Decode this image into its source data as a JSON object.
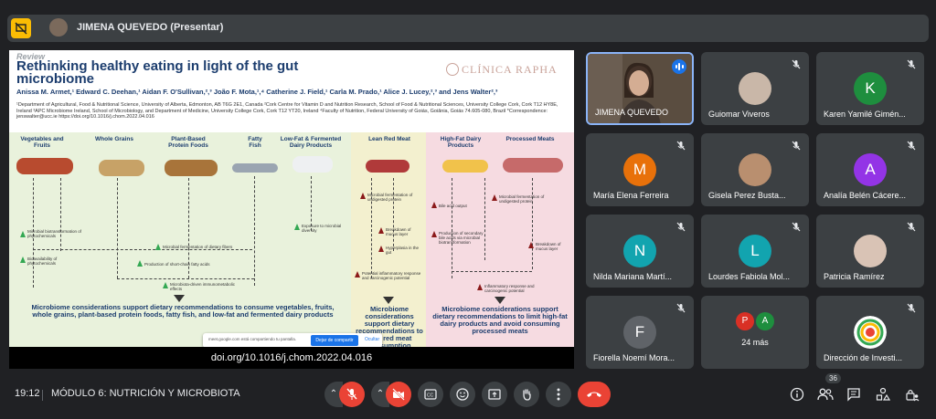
{
  "presenter": {
    "label": "JIMENA QUEVEDO (Presentar)"
  },
  "slide": {
    "review": "Review",
    "title": "Rethinking healthy eating in light of the gut microbiome",
    "logo": "CLÍNICA RAPHA",
    "authors": "Anissa M. Armet,¹ Edward C. Deehan,¹ Aidan F. O'Sullivan,²,³ João F. Mota,¹,⁴ Catherine J. Field,¹ Carla M. Prado,¹ Alice J. Lucey,²,³ and Jens Walter²,³",
    "affiliations": "¹Department of Agricultural, Food & Nutritional Science, University of Alberta, Edmonton, AB T6G 2E1, Canada ²Cork Centre for Vitamin D and Nutrition Research, School of Food & Nutritional Sciences, University College Cork, Cork T12 HY8E, Ireland ³APC Microbiome Ireland, School of Microbiology, and Department of Medicine, University College Cork, Cork T12 YT20, Ireland ⁴Faculty of Nutrition, Federal University of Goiás, Goiânia, Goiás 74.605-080, Brazil *Correspondence: jenswalter@ucc.ie https://doi.org/10.1016/j.chom.2022.04.016",
    "categories": [
      "Vegetables and Fruits",
      "Whole Grains",
      "Plant-Based Protein Foods",
      "Fatty Fish",
      "Low-Fat & Fermented Dairy Products",
      "Lean Red Meat",
      "High-Fat Dairy Products",
      "Processed Meats"
    ],
    "effects": [
      "Microbial biotransformation of phytochemicals",
      "Bioavailability of phytochemicals",
      "Microbial fermentation of dietary fibers",
      "Production of short-chain fatty acids",
      "Microbiota-driven immunometabolic effects",
      "Exposure to microbial diversity",
      "Microbial fermentation of undigested protein",
      "Breakdown of mucus layer",
      "Hyperplasia in the gut",
      "Potential inflammatory response and carcinogenic potential",
      "Bile acid output",
      "Production of secondary bile acids via microbial biotransformation",
      "Inflammatory response and carcinogenic potential"
    ],
    "conclusions": {
      "green": "Microbiome considerations support dietary recommendations to consume vegetables, fruits, whole grains, plant-based protein foods, fatty fish, and low-fat and fermented dairy products",
      "yellow": "Microbiome considerations support dietary recommendations to limit red meat consumption",
      "pink": "Microbiome considerations support dietary recommendations to limit high-fat dairy products and avoid consuming processed meats"
    },
    "toast": {
      "text": "meet.google.com está compartiendo tu pantalla.",
      "button": "Dejar de compartir",
      "link": "Ocultar"
    },
    "doi": "doi.org/10.1016/j.chom.2022.04.016"
  },
  "participants": [
    {
      "name": "JIMENA QUEVEDO",
      "type": "video",
      "speaking": true
    },
    {
      "name": "Guiomar Viveros",
      "type": "photo",
      "color": "#c9b7a8"
    },
    {
      "name": "Karen Yamilé Gimén...",
      "type": "letter",
      "letter": "K",
      "color": "#1e8e3e"
    },
    {
      "name": "María Elena Ferreira",
      "type": "letter",
      "letter": "M",
      "color": "#e8710a"
    },
    {
      "name": "Gisela Perez Busta...",
      "type": "photo",
      "color": "#b98f6f"
    },
    {
      "name": "Analía Belén Cácere...",
      "type": "letter",
      "letter": "A",
      "color": "#9334e6"
    },
    {
      "name": "Nilda Mariana Martí...",
      "type": "letter",
      "letter": "N",
      "color": "#12a4af"
    },
    {
      "name": "Lourdes Fabiola Mol...",
      "type": "letter",
      "letter": "L",
      "color": "#12a4af"
    },
    {
      "name": "Patricia Ramírez",
      "type": "photo",
      "color": "#d9c3b5"
    },
    {
      "name": "Fiorella Noemí Mora...",
      "type": "letter",
      "letter": "F",
      "color": "#5f6368"
    },
    {
      "name": "24 más",
      "type": "more",
      "letters": [
        "P",
        "A"
      ],
      "colors": [
        "#d93025",
        "#1e8e3e"
      ]
    },
    {
      "name": "Dirección de Investi...",
      "type": "logo"
    }
  ],
  "bottom": {
    "time": "19:12",
    "meeting": "MÓDULO 6: NUTRICIÓN Y MICROBIOTA",
    "participant_count": "36"
  },
  "colors": {
    "bg": "#202124",
    "tile": "#3c4043",
    "red": "#ea4335",
    "accent": "#1a73e8"
  }
}
